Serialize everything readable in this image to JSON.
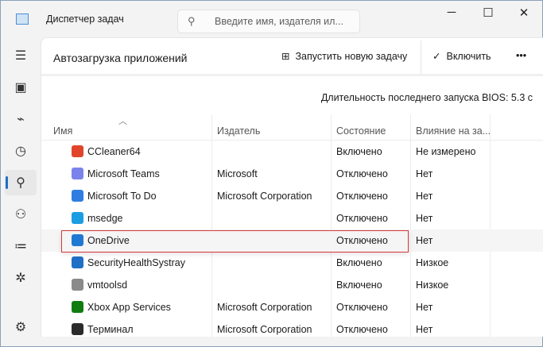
{
  "window": {
    "title": "Диспетчер задач",
    "minimize": "─",
    "maximize": "☐",
    "close": "✕"
  },
  "search": {
    "placeholder": "Введите имя, издателя ил..."
  },
  "sidebar": [
    {
      "name": "menu"
    },
    {
      "name": "processes"
    },
    {
      "name": "performance"
    },
    {
      "name": "app-history"
    },
    {
      "name": "startup-apps",
      "active": true
    },
    {
      "name": "users"
    },
    {
      "name": "details"
    },
    {
      "name": "services"
    },
    {
      "name": "settings"
    }
  ],
  "page": {
    "title": "Автозагрузка приложений",
    "run_task": "Запустить новую задачу",
    "enable": "Включить",
    "more": "•••",
    "bios": "Длительность последнего запуска BIOS: 5.3 с"
  },
  "columns": {
    "name": "Имя",
    "publisher": "Издатель",
    "status": "Состояние",
    "impact": "Влияние на за..."
  },
  "rows": [
    {
      "name": "CCleaner64",
      "publisher": "",
      "status": "Включено",
      "impact": "Не измерено",
      "icon": "ccleaner-icon",
      "color": "#e0452b"
    },
    {
      "name": "Microsoft Teams",
      "publisher": "Microsoft",
      "status": "Отключено",
      "impact": "Нет",
      "icon": "teams-icon",
      "color": "#7b83eb"
    },
    {
      "name": "Microsoft To Do",
      "publisher": "Microsoft Corporation",
      "status": "Отключено",
      "impact": "Нет",
      "icon": "todo-icon",
      "color": "#2f7de1"
    },
    {
      "name": "msedge",
      "publisher": "",
      "status": "Отключено",
      "impact": "Нет",
      "icon": "edge-icon",
      "color": "#1b9de2"
    },
    {
      "name": "OneDrive",
      "publisher": "",
      "status": "Отключено",
      "impact": "Нет",
      "icon": "onedrive-icon",
      "color": "#1f78d1"
    },
    {
      "name": "SecurityHealthSystray",
      "publisher": "",
      "status": "Включено",
      "impact": "Низкое",
      "icon": "shield-icon",
      "color": "#1f6fc5"
    },
    {
      "name": "vmtoolsd",
      "publisher": "",
      "status": "Включено",
      "impact": "Низкое",
      "icon": "vmware-icon",
      "color": "#8a8a8a"
    },
    {
      "name": "Xbox App Services",
      "publisher": "Microsoft Corporation",
      "status": "Отключено",
      "impact": "Нет",
      "icon": "xbox-icon",
      "color": "#107c10"
    },
    {
      "name": "Терминал",
      "publisher": "Microsoft Corporation",
      "status": "Отключено",
      "impact": "Нет",
      "icon": "terminal-icon",
      "color": "#2b2b2b"
    }
  ]
}
